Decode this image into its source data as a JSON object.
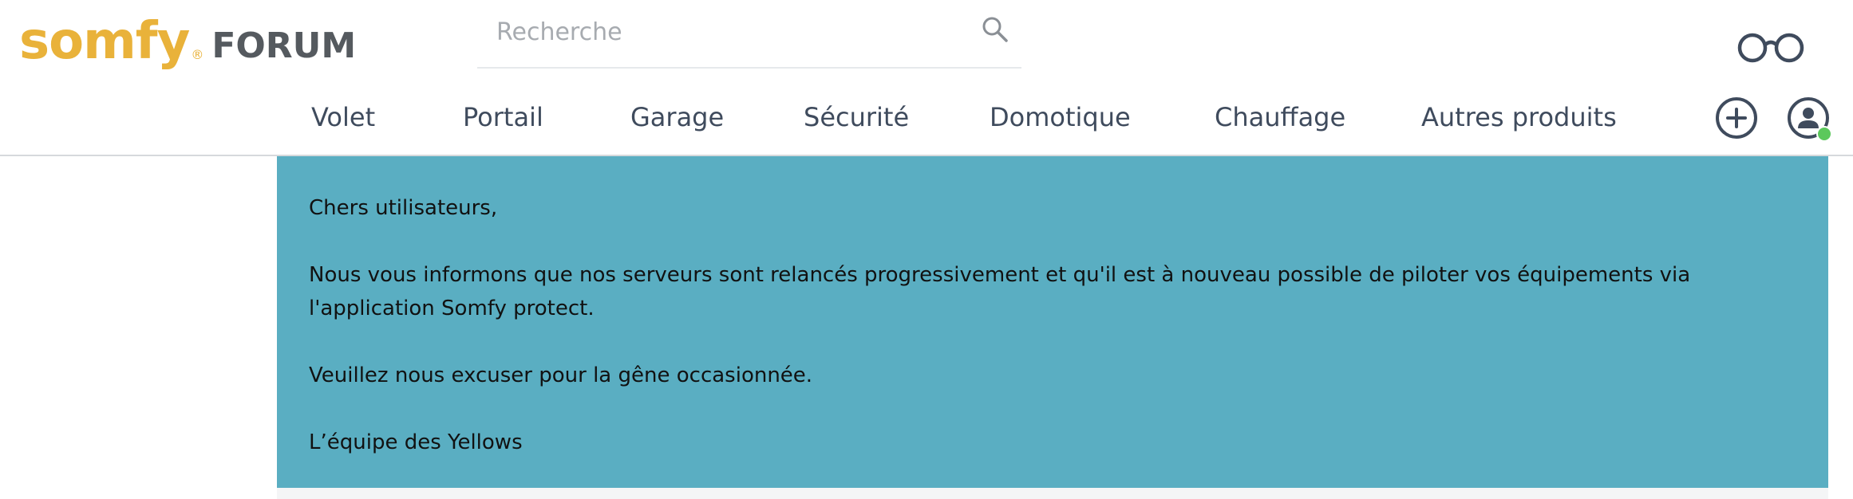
{
  "header": {
    "logo_brand": "somfy",
    "logo_registered": "®",
    "logo_suffix": "FORUM",
    "brand_color": "#e9b23a",
    "search_placeholder": "Recherche",
    "search_value": "",
    "icons": [
      "search-icon",
      "glasses-icon",
      "plus-circle-icon",
      "user-icon"
    ]
  },
  "nav": {
    "items": [
      {
        "label": "Volet"
      },
      {
        "label": "Portail"
      },
      {
        "label": "Garage"
      },
      {
        "label": "Sécurité"
      },
      {
        "label": "Domotique"
      },
      {
        "label": "Chauffage"
      },
      {
        "label": "Autres produits"
      }
    ]
  },
  "banner": {
    "background_color": "#5aaec2",
    "greeting": "Chers utilisateurs,",
    "message": "Nous vous informons que nos serveurs sont relancés progressivement et qu'il est à nouveau possible de piloter vos équipements via l'application Somfy protect.",
    "apology": "Veuillez nous excuser pour la gêne occasionnée.",
    "signature": "L’équipe des Yellows"
  },
  "status": {
    "online_color": "#5cc85c"
  }
}
